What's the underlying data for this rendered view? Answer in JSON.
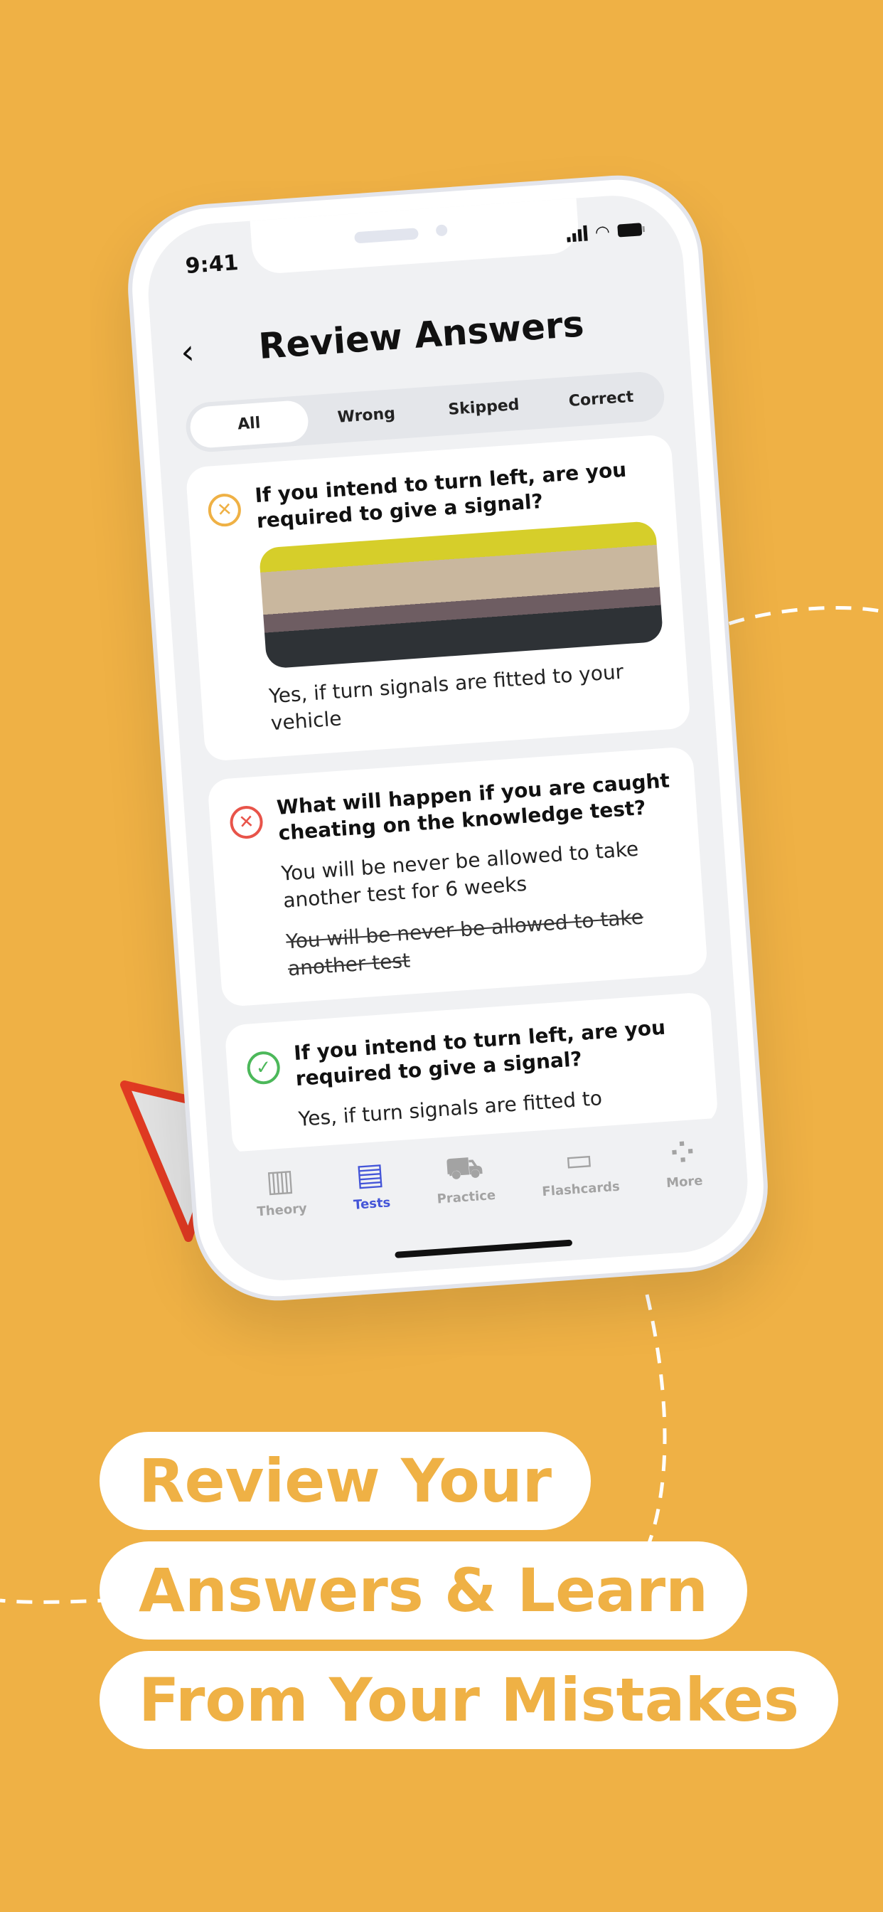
{
  "status_bar": {
    "time": "9:41"
  },
  "header": {
    "title": "Review Answers",
    "back_icon": "chevron-left-icon"
  },
  "filter_tabs": [
    {
      "label": "All",
      "active": true
    },
    {
      "label": "Wrong"
    },
    {
      "label": "Skipped"
    },
    {
      "label": "Correct"
    }
  ],
  "questions": [
    {
      "status": "skipped",
      "icon": "x-circle-icon",
      "color": "#EFB145",
      "question": "If you intend to turn left,  are you required to give a signal?",
      "answer": "Yes, if turn signals are fitted to your vehicle"
    },
    {
      "status": "wrong",
      "icon": "x-circle-icon",
      "color": "#E8544A",
      "question": "What will happen if you are caught cheating on the knowledge test?",
      "answer": "You will be never be allowed to take another test for 6 weeks",
      "wrong_answer": "You will be never be allowed to take another test"
    },
    {
      "status": "correct",
      "icon": "check-circle-icon",
      "color": "#4CB85A",
      "question": "If you intend to turn left,  are you required to give a signal?",
      "answer": "Yes, if turn signals are fitted to"
    }
  ],
  "bottom_nav": [
    {
      "label": "Theory",
      "icon": "books-icon"
    },
    {
      "label": "Tests",
      "icon": "notebook-icon",
      "active": true
    },
    {
      "label": "Practice",
      "icon": "car-icon"
    },
    {
      "label": "Flashcards",
      "icon": "card-box-icon"
    },
    {
      "label": "More",
      "icon": "grid-circles-icon"
    }
  ],
  "headline": [
    "Review Your",
    "Answers & Learn",
    "From Your Mistakes"
  ],
  "colors": {
    "background": "#EFB145",
    "accent": "#4455D8"
  }
}
